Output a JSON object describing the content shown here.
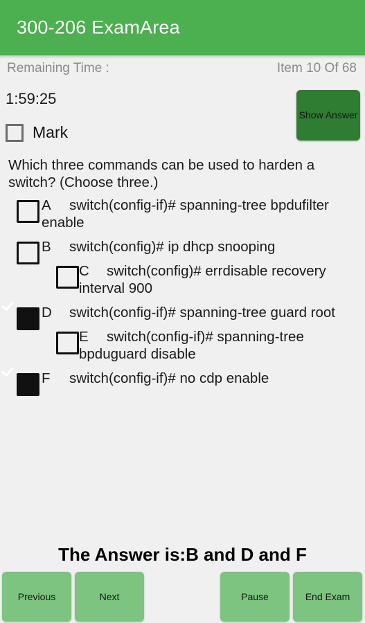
{
  "app": {
    "title": "300-206 ExamArea",
    "header_color": "#4caf50",
    "background_color": "#f0f0f0"
  },
  "status": {
    "remaining_time_label": "Remaining Time :",
    "item_counter": "Item 10 Of 68",
    "timer_value": "1:59:25"
  },
  "actions": {
    "show_answer_label": "Show Answer",
    "show_answer_color": "#2e7d32"
  },
  "mark": {
    "label": "Mark",
    "checked": false
  },
  "question": {
    "text": "Which three commands can be used to harden a switch? (Choose three.)",
    "options": [
      {
        "letter": "A",
        "text": "switch(config-if)# spanning-tree bpdufilter enable",
        "checked": false
      },
      {
        "letter": "B",
        "text": "switch(config)# ip dhcp snooping",
        "checked": false
      },
      {
        "letter": "C",
        "text": "switch(config)# errdisable recovery interval 900",
        "checked": false
      },
      {
        "letter": "D",
        "text": "switch(config-if)# spanning-tree guard root",
        "checked": true
      },
      {
        "letter": "E",
        "text": "switch(config-if)# spanning-tree bpduguard disable",
        "checked": false
      },
      {
        "letter": "F",
        "text": "switch(config-if)# no cdp enable",
        "checked": true
      }
    ]
  },
  "answer": {
    "reveal_text": "The Answer is:B and D and F"
  },
  "nav": {
    "previous_label": "Previous",
    "next_label": "Next",
    "pause_label": "Pause",
    "end_exam_label": "End Exam",
    "button_color": "#7cc47f"
  }
}
